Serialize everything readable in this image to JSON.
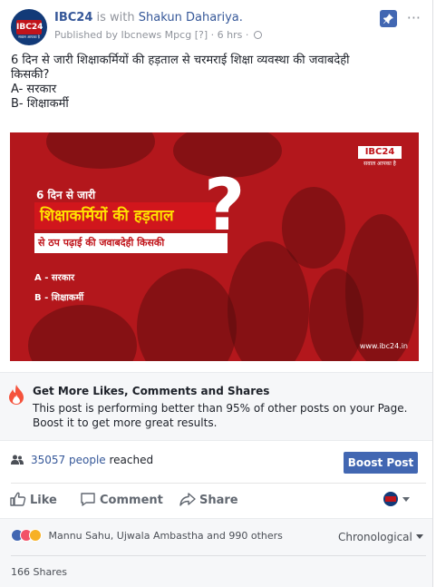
{
  "header": {
    "page_name": "IBC24",
    "is_with": "is with",
    "tagged_person": "Shakun Dahariya.",
    "published_by": "Published by Ibcnews Mpcg",
    "help": "[?]",
    "separator": "·",
    "time": "6 hrs",
    "separator2": "·",
    "more": "···"
  },
  "avatar": {
    "logo_text": "IBC24",
    "tagline": "सवाल आपका है"
  },
  "post": {
    "line1": "6 दिन से जारी शिक्षाकर्मियों की हड़ताल से चरमराई शिक्षा व्यवस्था की जवाबदेही",
    "line2": "किसकी?",
    "line3": "A- सरकार",
    "line4": "B- शिक्षाकर्मी"
  },
  "image": {
    "logo": "IBC24",
    "logo_tag": "सवाल आपका है",
    "line1": "6 दिन से जारी",
    "banner": "शिक्षाकर्मियों की हड़ताल",
    "line3": "से ठप पढ़ाई की जवाबदेही किसकी",
    "option_a": "A - सरकार",
    "option_b": "B - शिक्षाकर्मी",
    "question_mark": "?",
    "url": "www.ibc24.in"
  },
  "boost_panel": {
    "title": "Get More Likes, Comments and Shares",
    "body": "This post is performing better than 95% of other posts on your Page. Boost it to get more great results."
  },
  "reach": {
    "count": "35057 people",
    "label": "reached"
  },
  "boost_button": "Boost Post",
  "actions": {
    "like": "Like",
    "comment": "Comment",
    "share": "Share"
  },
  "reactions": {
    "names": "Mannu Sahu, Ujwala Ambastha and 990 others",
    "sort": "Chronological"
  },
  "shares": "166 Shares",
  "colors": {
    "brand": "#4267b2",
    "link": "#365899",
    "ibc_red": "#c0141a",
    "image_red": "#b3171c"
  }
}
